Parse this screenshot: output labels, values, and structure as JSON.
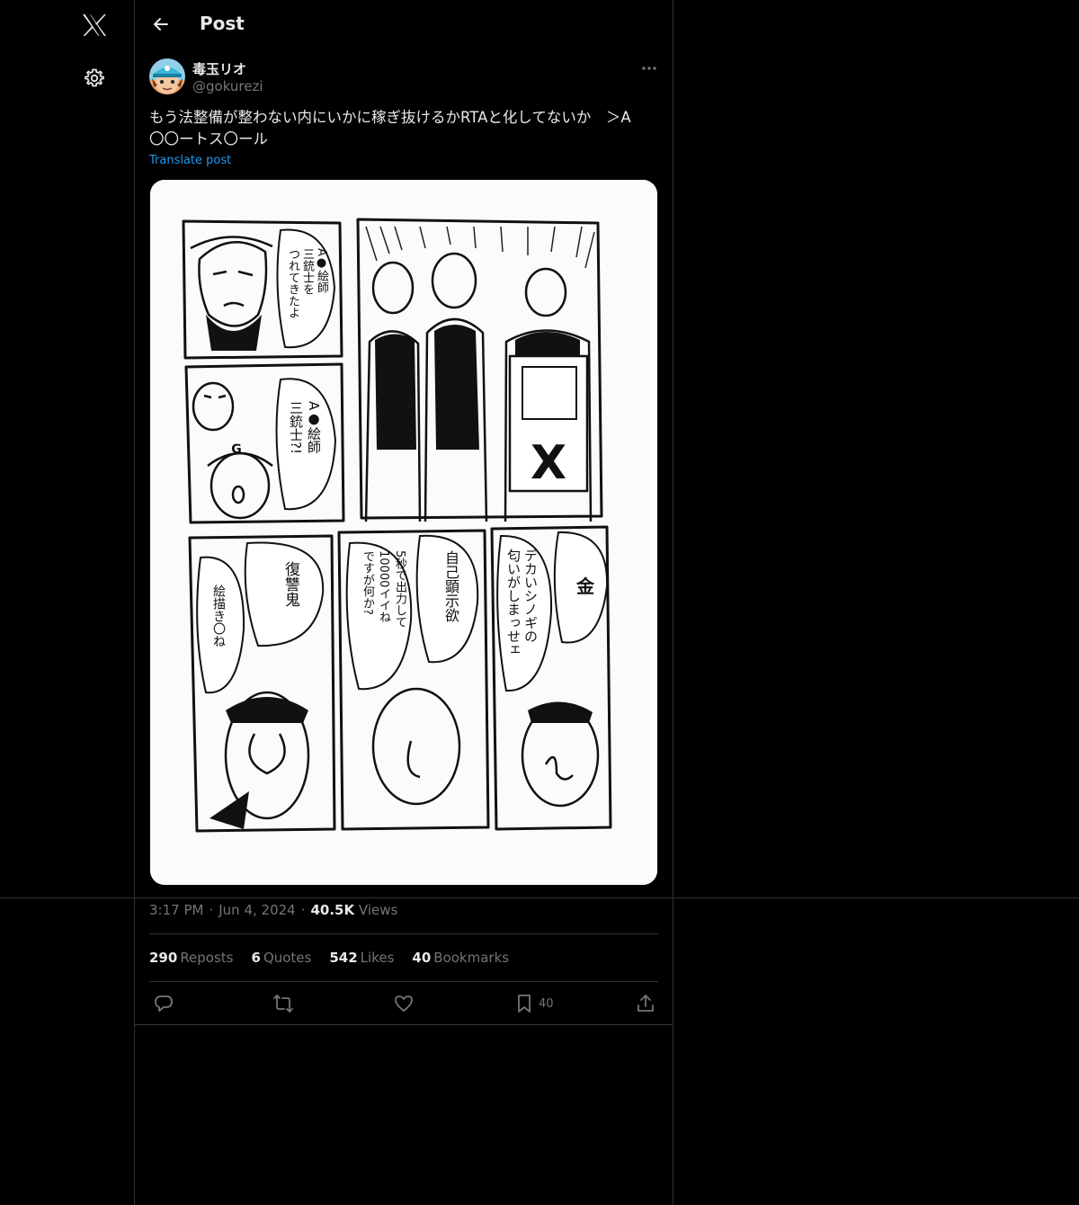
{
  "nav": {
    "logo_icon": "x-logo-icon",
    "settings_icon": "gear-icon"
  },
  "header": {
    "title": "Post",
    "back_icon": "arrow-left-icon"
  },
  "post": {
    "author": {
      "display_name": "毒玉リオ",
      "handle": "@gokurezi"
    },
    "text": "もう法整備が整わない内にいかに稼ぎ抜けるかRTAと化してないか　＞A\n〇〇ートス〇ール",
    "translate_label": "Translate post",
    "time": "3:17 PM",
    "date": "Jun 4, 2024",
    "views_count": "40.5K",
    "views_label": "Views",
    "stats": {
      "reposts_count": "290",
      "reposts_label": "Reposts",
      "quotes_count": "6",
      "quotes_label": "Quotes",
      "likes_count": "542",
      "likes_label": "Likes",
      "bookmarks_count": "40",
      "bookmarks_label": "Bookmarks"
    },
    "actions": {
      "reply_icon": "reply-icon",
      "repost_icon": "repost-icon",
      "like_icon": "heart-icon",
      "bookmark_icon": "bookmark-icon",
      "bookmark_count": "40",
      "share_icon": "share-icon"
    }
  },
  "comic": {
    "p1_speech": "A●絵師\n三銃士を\nつれてきたよ",
    "p3_speech": "A●絵師\n三銃士?!",
    "cap_badge": "G",
    "shirt_logo": "X",
    "p4_bubble1": "金",
    "p4_bubble2": "デカいシノギの\n匂いがしまっせェ",
    "p5_bubble1": "自己顕示欲",
    "p5_bubble2": "5秒で出力して\n10000イイね\nですが何か?",
    "p6_bubble1": "復讐鬼",
    "p6_bubble2": "絵描き〇ね"
  },
  "colors": {
    "accent": "#1d9bf0",
    "muted": "#71767b",
    "text": "#e7e9ea",
    "border": "#2f3336"
  }
}
